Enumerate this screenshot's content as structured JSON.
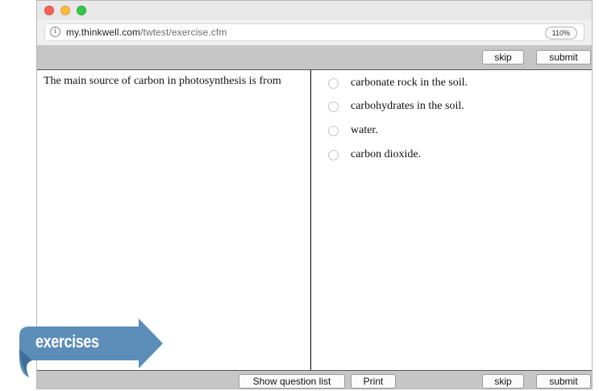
{
  "browser": {
    "url_host": "my.thinkwell.com",
    "url_path": "/twtest/exercise.cfm",
    "zoom": "110%"
  },
  "toolbar_top": {
    "skip_label": "skip",
    "submit_label": "submit"
  },
  "question": {
    "text": "The main source of carbon in photosynthesis is from"
  },
  "answers": [
    {
      "label": "carbonate rock in the soil."
    },
    {
      "label": "carbohydrates in the soil."
    },
    {
      "label": "water."
    },
    {
      "label": "carbon dioxide."
    }
  ],
  "toolbar_bottom": {
    "show_list_label": "Show question list",
    "print_label": "Print",
    "skip_label": "skip",
    "submit_label": "submit"
  },
  "banner": {
    "label": "exercises",
    "color": "#5b8db8"
  },
  "colors": {
    "toolbar_bg": "#c6c6c6",
    "close_dot": "#fc605b",
    "minimize_dot": "#fdbc40",
    "zoom_dot": "#34c84a"
  }
}
